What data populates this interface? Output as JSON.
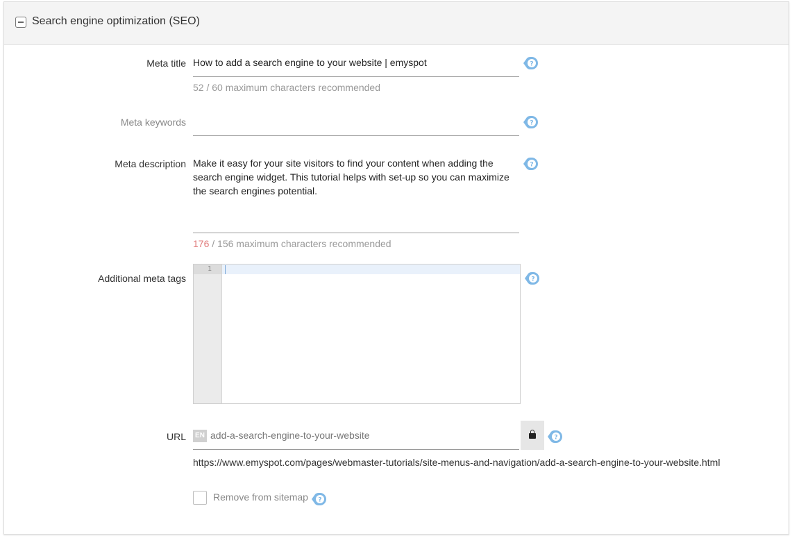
{
  "section": {
    "title": "Search engine optimization (SEO)"
  },
  "meta_title": {
    "label": "Meta title",
    "value": "How to add a search engine to your website | emyspot",
    "count": "52",
    "counter_suffix": " / 60 maximum characters recommended"
  },
  "meta_keywords": {
    "label": "Meta keywords",
    "value": ""
  },
  "meta_description": {
    "label": "Meta description",
    "value": "Make it easy for your site visitors to find your content when adding the search engine widget. This tutorial helps with set-up so you can maximize the search engines potential.",
    "count": "176",
    "counter_suffix": " / 156 maximum characters recommended"
  },
  "additional_meta_tags": {
    "label": "Additional meta tags",
    "line_number": "1"
  },
  "url": {
    "label": "URL",
    "lang": "EN",
    "slug": "add-a-search-engine-to-your-website",
    "full": "https://www.emyspot.com/pages/webmaster-tutorials/site-menus-and-navigation/add-a-search-engine-to-your-website.html"
  },
  "sitemap": {
    "label": "Remove from sitemap",
    "checked": false
  },
  "icons": {
    "help": "help-icon",
    "lock": "lock-icon",
    "collapse": "collapse-icon"
  },
  "colors": {
    "help_accent": "#7fb8e6",
    "over_limit": "#e07a7a"
  }
}
